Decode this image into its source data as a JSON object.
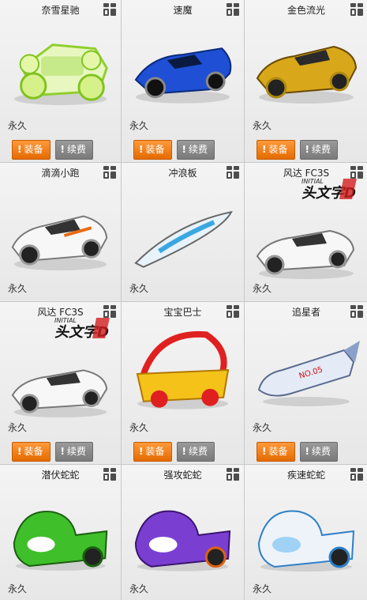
{
  "items": [
    {
      "name": "奈雪星驰",
      "duration": "永久",
      "buy": "装备",
      "renew": "续费",
      "icon": "lime-buggy"
    },
    {
      "name": "速魔",
      "duration": "永久",
      "buy": "装备",
      "renew": "续费",
      "icon": "blue-sports-car"
    },
    {
      "name": "金色流光",
      "duration": "永久",
      "buy": "装备",
      "renew": "续费",
      "icon": "gold-race-car"
    },
    {
      "name": "滴滴小跑",
      "duration": "永久",
      "icon": "white-coupe"
    },
    {
      "name": "冲浪板",
      "duration": "永久",
      "icon": "surfboard"
    },
    {
      "name": "风达 FC3S",
      "duration": "永久",
      "icon": "white-fc3s",
      "logo": "头文字D",
      "logo_sub": "INITIAL"
    },
    {
      "name": "风达 FC3S",
      "duration": "永久",
      "buy": "装备",
      "renew": "续费",
      "icon": "white-fc3s",
      "logo": "头文字D",
      "logo_sub": "INITIAL"
    },
    {
      "name": "宝宝巴士",
      "duration": "永久",
      "buy": "装备",
      "renew": "续费",
      "icon": "baby-bus"
    },
    {
      "name": "追星者",
      "duration": "永久",
      "buy": "装备",
      "renew": "续费",
      "icon": "rocket-car",
      "rocket_text": "NO.05"
    },
    {
      "name": "潜伏蛇蛇",
      "duration": "永久",
      "icon": "green-snake-kart"
    },
    {
      "name": "强攻蛇蛇",
      "duration": "永久",
      "icon": "purple-snake-kart"
    },
    {
      "name": "疾速蛇蛇",
      "duration": "永久",
      "icon": "white-snake-kart"
    }
  ],
  "button_mark": "!",
  "colors": {
    "buy": "#f07a10",
    "renew": "#8a8a8a"
  }
}
